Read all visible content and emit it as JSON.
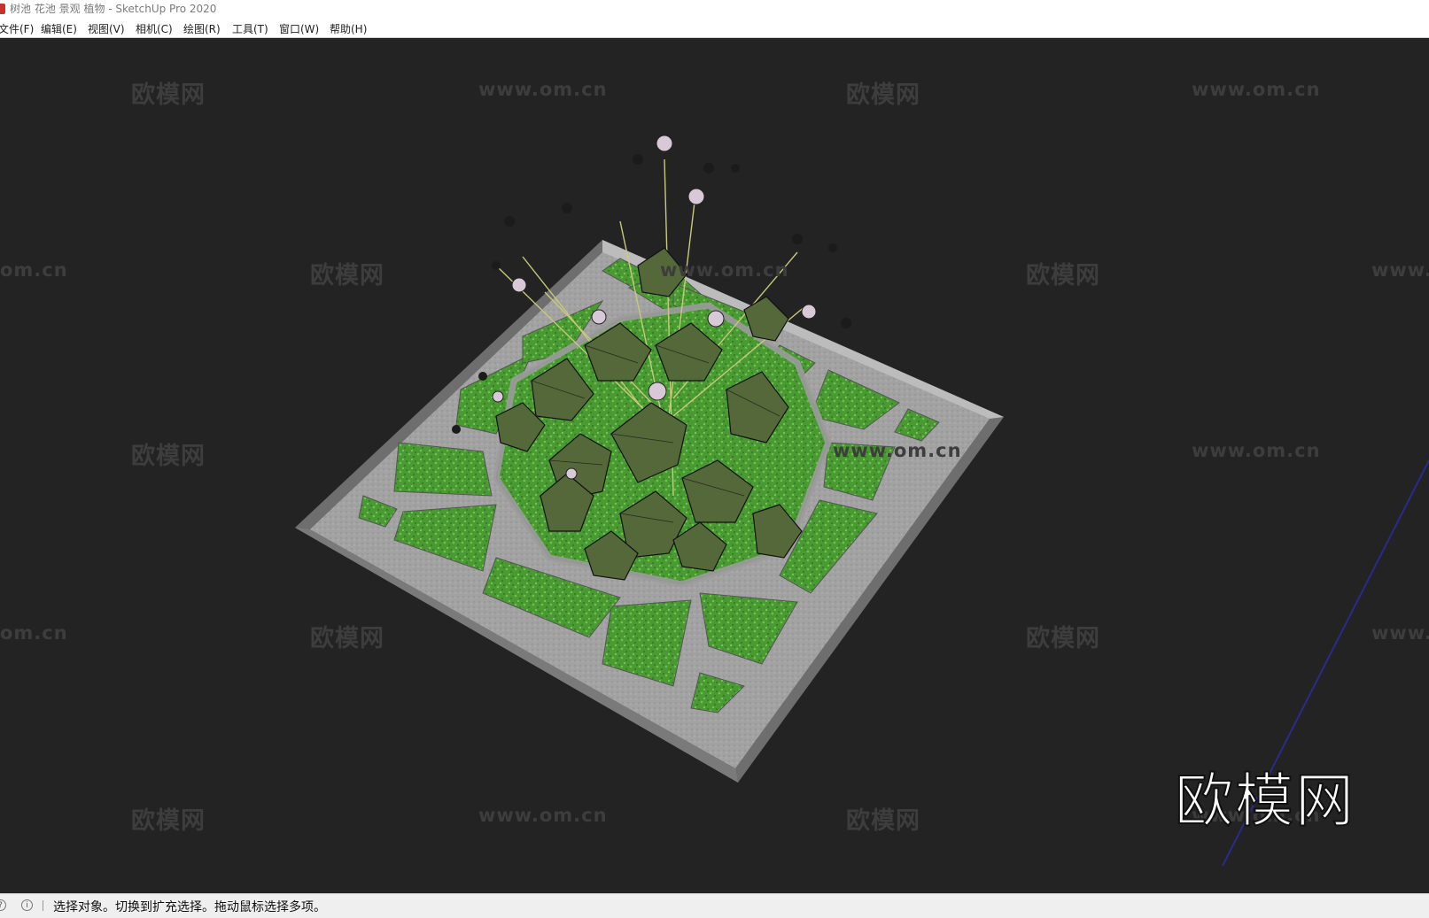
{
  "window": {
    "title": "树池 花池 景观 植物 - SketchUp Pro 2020"
  },
  "menu": [
    {
      "label": "文件(F)"
    },
    {
      "label": "编辑(E)"
    },
    {
      "label": "视图(V)"
    },
    {
      "label": "相机(C)"
    },
    {
      "label": "绘图(R)"
    },
    {
      "label": "工具(T)"
    },
    {
      "label": "窗口(W)"
    },
    {
      "label": "帮助(H)"
    }
  ],
  "watermark": {
    "text": "欧模网",
    "url": "www.om.cn",
    "url_partial_right": "www.",
    "url_partial_left": "om.cn"
  },
  "logo": {
    "text": "欧模网"
  },
  "status": {
    "message": "选择对象。切换到扩充选择。拖动鼠标选择多项。"
  },
  "colors": {
    "background": "#232323",
    "grass": "#4e9a35",
    "stone": "#9a9a9a",
    "leaf": "#566b3a",
    "axis": "#2a2a8f"
  }
}
